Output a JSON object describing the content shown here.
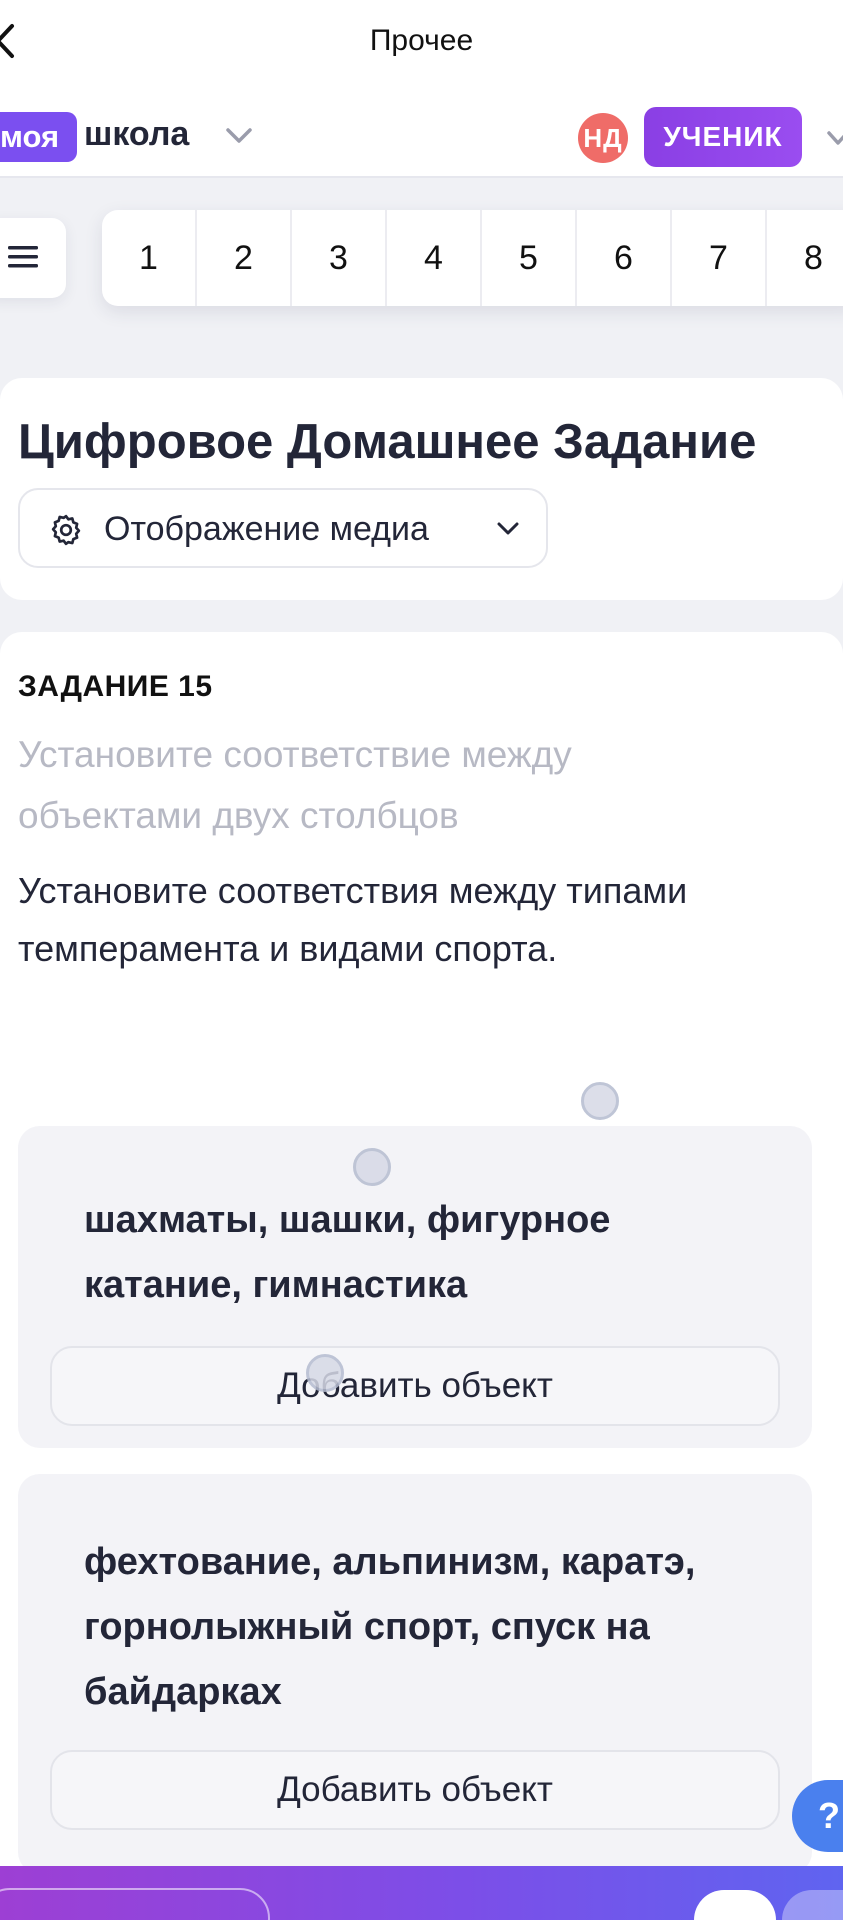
{
  "topnav": {
    "title": "Прочее"
  },
  "header": {
    "brand_pill": "моя",
    "brand_word": "школа",
    "avatar_initials": "НД",
    "role": "УЧЕНИК"
  },
  "task_nav": {
    "numbers": [
      "1",
      "2",
      "3",
      "4",
      "5",
      "6",
      "7",
      "8"
    ]
  },
  "main": {
    "title": "Цифровое Домашнее Задание",
    "media_button": "Отображение медиа"
  },
  "task": {
    "number": "ЗАДАНИЕ 15",
    "subtitle": "Установите соответствие между объектами двух столбцов",
    "text": "Установите соответствия между типами темперамента и видами спорта.",
    "targets": [
      {
        "label": "шахматы, шашки, фигурное катание, гимнастика",
        "add_button": "Добавить объект"
      },
      {
        "label": "фехтование, альпинизм, каратэ, горнолыжный спорт, спуск на байдарках",
        "add_button": "Добавить объект"
      }
    ]
  },
  "help": {
    "label": "?"
  },
  "colors": {
    "brand_purple": "#7b4ff0",
    "avatar_red": "#ef6c68",
    "help_blue": "#4a80ee",
    "text_dark": "#232638",
    "text_muted": "#b7b9c4"
  }
}
